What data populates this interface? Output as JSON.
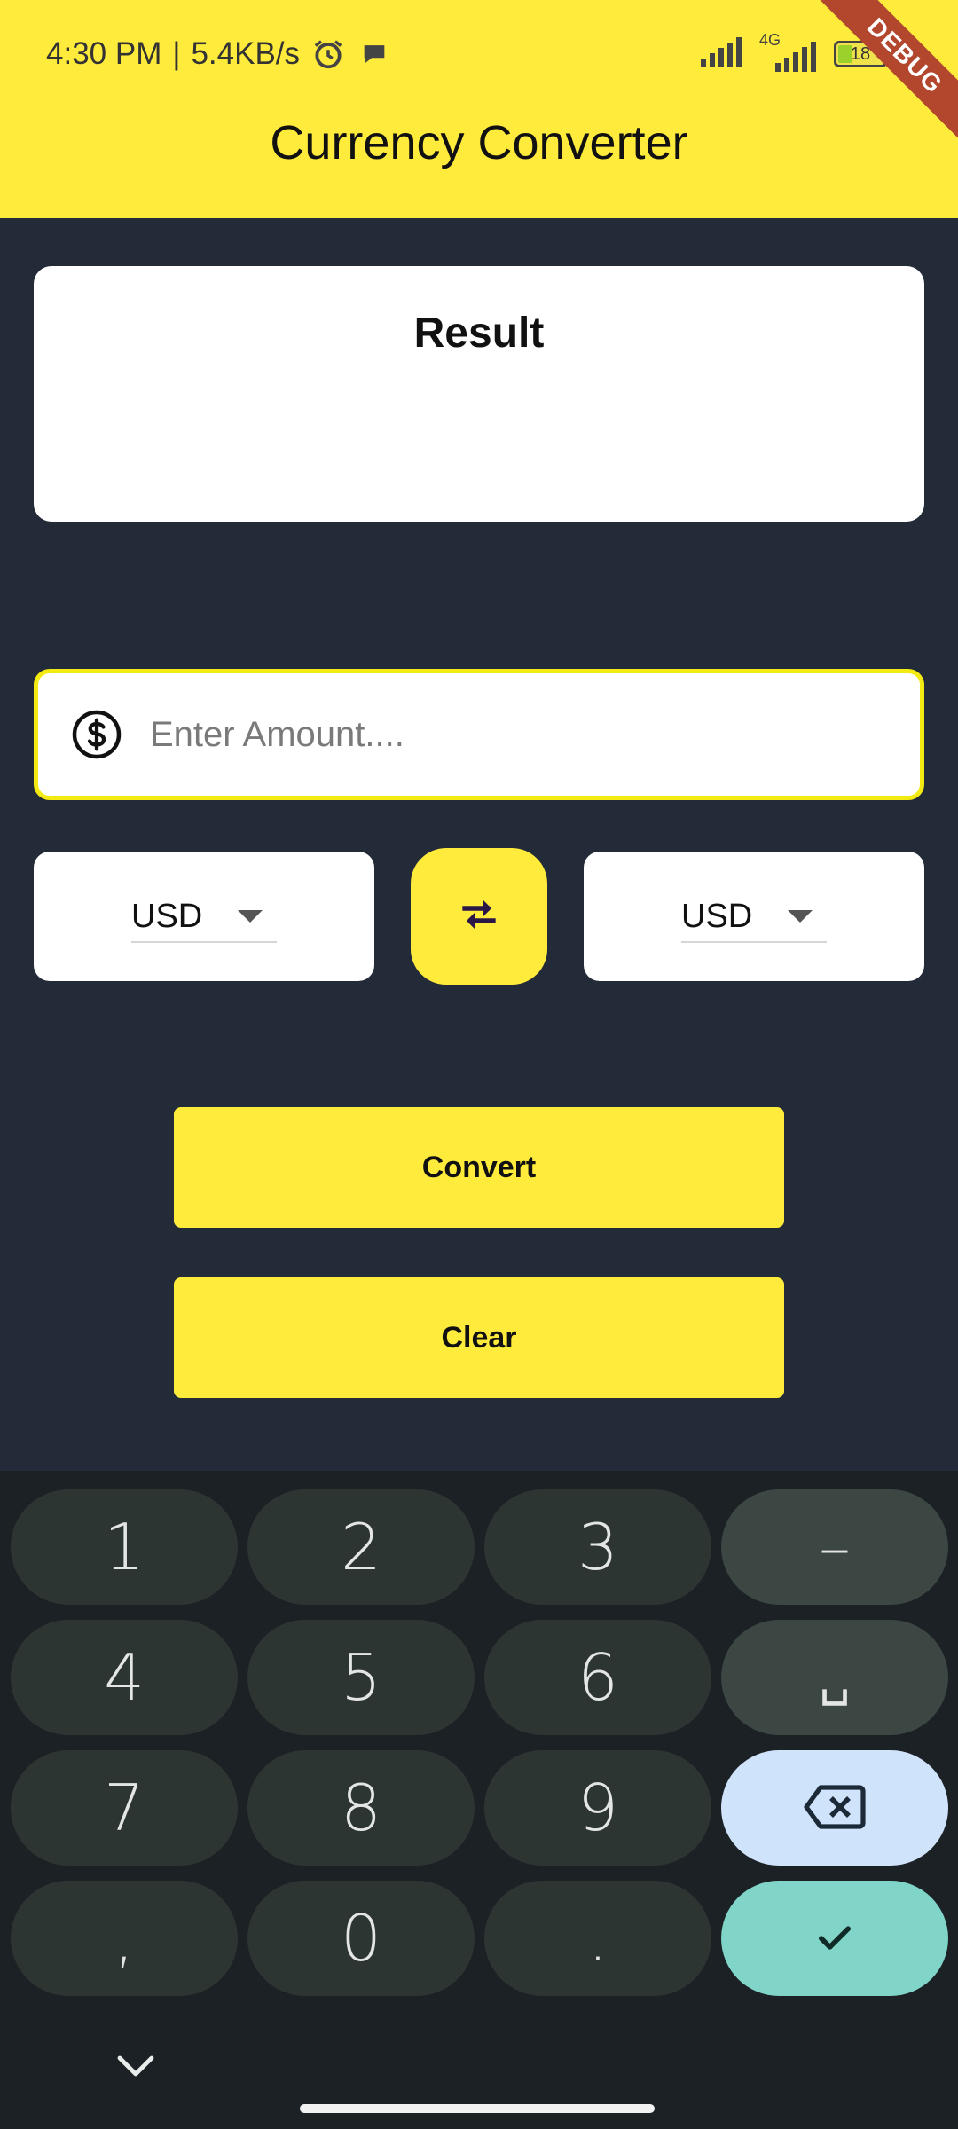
{
  "status_bar": {
    "time": "4:30 PM",
    "separator": "|",
    "speed": "5.4KB/s",
    "network_label": "4G",
    "battery": "18",
    "icons": [
      "alarm-icon",
      "chat-bubble-icon",
      "signal-icon",
      "signal-4g-icon",
      "battery-icon"
    ]
  },
  "debug_banner": "DEBUG",
  "app_bar": {
    "title": "Currency Converter"
  },
  "result": {
    "title": "Result",
    "value": ""
  },
  "amount_input": {
    "placeholder": "Enter Amount....",
    "value": "",
    "icon": "dollar-circle-icon"
  },
  "from_currency": {
    "value": "USD"
  },
  "to_currency": {
    "value": "USD"
  },
  "swap_button": {
    "icon": "swap-arrows-icon"
  },
  "buttons": {
    "convert": "Convert",
    "clear": "Clear"
  },
  "keyboard": {
    "rows": [
      [
        "1",
        "2",
        "3",
        "–"
      ],
      [
        "4",
        "5",
        "6",
        "␣"
      ],
      [
        "7",
        "8",
        "9",
        "⌫"
      ],
      [
        ",",
        "0",
        ".",
        "✓"
      ]
    ]
  },
  "colors": {
    "accent": "#ffeb3b",
    "background": "#232a38",
    "input_border": "#f3ea12",
    "keyboard_bg": "#1b2124",
    "key_bg": "#2d3533",
    "backspace_key": "#cfe3fb",
    "enter_key": "#80d4c8"
  }
}
